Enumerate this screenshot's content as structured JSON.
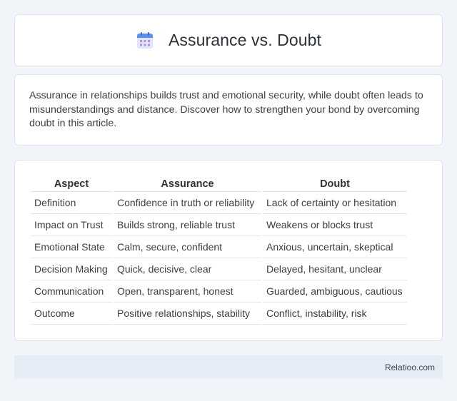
{
  "header": {
    "title": "Assurance vs. Doubt",
    "icon": "calendar-icon"
  },
  "intro": {
    "text": "Assurance in relationships builds trust and emotional security, while doubt often leads to misunderstandings and distance. Discover how to strengthen your bond by overcoming doubt in this article."
  },
  "table": {
    "headers": [
      "Aspect",
      "Assurance",
      "Doubt"
    ],
    "rows": [
      [
        "Definition",
        "Confidence in truth or reliability",
        "Lack of certainty or hesitation"
      ],
      [
        "Impact on Trust",
        "Builds strong, reliable trust",
        "Weakens or blocks trust"
      ],
      [
        "Emotional State",
        "Calm, secure, confident",
        "Anxious, uncertain, skeptical"
      ],
      [
        "Decision Making",
        "Quick, decisive, clear",
        "Delayed, hesitant, unclear"
      ],
      [
        "Communication",
        "Open, transparent, honest",
        "Guarded, ambiguous, cautious"
      ],
      [
        "Outcome",
        "Positive relationships, stability",
        "Conflict, instability, risk"
      ]
    ]
  },
  "footer": {
    "text": "Relatioo.com"
  },
  "colors": {
    "background": "#f1f4f9",
    "card": "#ffffff",
    "footer": "#e7edf7",
    "icon_accent": "#5b8def"
  }
}
